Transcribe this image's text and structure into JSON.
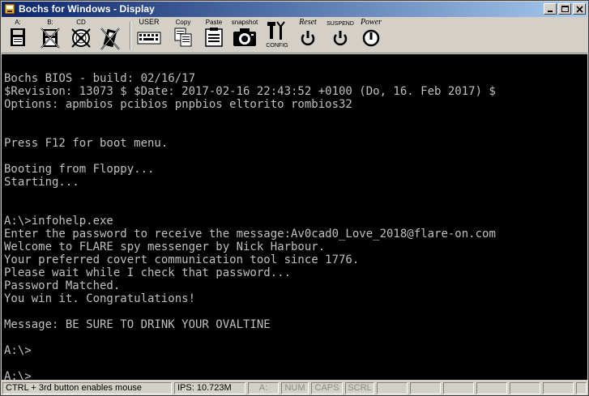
{
  "window": {
    "title": "Bochs for Windows - Display",
    "controls": [
      "minimize",
      "maximize",
      "close"
    ]
  },
  "toolbar": {
    "items": [
      {
        "id": "floppy-a",
        "label": "A:",
        "icon": "floppy-disk-icon"
      },
      {
        "id": "floppy-b",
        "label": "B:",
        "icon": "floppy-disk-disabled-icon"
      },
      {
        "id": "cdrom",
        "label": "CD",
        "icon": "cdrom-disabled-icon"
      },
      {
        "id": "usb",
        "label": "",
        "icon": "usb-disabled-icon"
      },
      {
        "id": "user",
        "label": "USER",
        "icon": "keyboard-icon"
      },
      {
        "id": "copy",
        "label": "Copy",
        "icon": "copy-icon"
      },
      {
        "id": "paste",
        "label": "Paste",
        "icon": "paste-icon"
      },
      {
        "id": "snapshot",
        "label": "snapshot",
        "icon": "camera-icon"
      },
      {
        "id": "config",
        "label": "CONFIG",
        "icon": "config-tools-icon"
      },
      {
        "id": "reset",
        "label": "Reset",
        "icon": "reset-icon"
      },
      {
        "id": "suspend",
        "label": "SUSPEND",
        "icon": "suspend-icon"
      },
      {
        "id": "power",
        "label": "Power",
        "icon": "power-icon"
      }
    ]
  },
  "screen": {
    "lines": [
      "",
      "Bochs BIOS - build: 02/16/17",
      "$Revision: 13073 $ $Date: 2017-02-16 22:43:52 +0100 (Do, 16. Feb 2017) $",
      "Options: apmbios pcibios pnpbios eltorito rombios32",
      "",
      "",
      "Press F12 for boot menu.",
      "",
      "Booting from Floppy...",
      "Starting...",
      "",
      "",
      "A:\\>infohelp.exe",
      "Enter the password to receive the message:Av0cad0_Love_2018@flare-on.com",
      "Welcome to FLARE spy messenger by Nick Harbour.",
      "Your preferred covert communication tool since 1776.",
      "Please wait while I check that password...",
      "Password Matched.",
      "You win it. Congratulations!",
      "",
      "Message: BE SURE TO DRINK YOUR OVALTINE",
      "",
      "A:\\>",
      "",
      "A:\\>"
    ]
  },
  "statusbar": {
    "mouse_hint": "CTRL + 3rd button enables mouse",
    "ips": "IPS: 10.723M",
    "drive": "A:",
    "num": "NUM",
    "caps": "CAPS",
    "scrl": "SCRL"
  }
}
